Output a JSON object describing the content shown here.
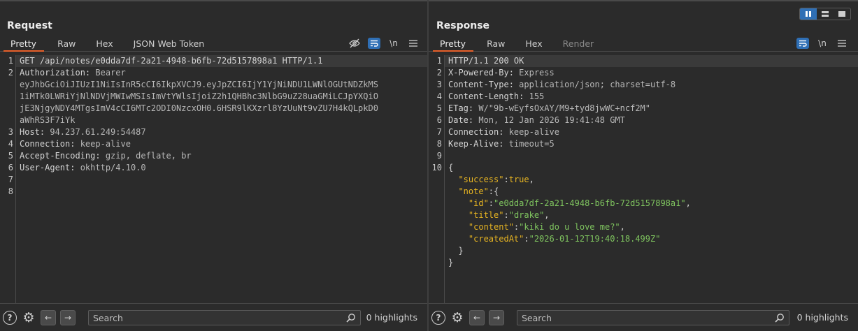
{
  "request": {
    "title": "Request",
    "tabs": [
      "Pretty",
      "Raw",
      "Hex",
      "JSON Web Token"
    ],
    "lines": [
      {
        "n": "1",
        "parts": [
          {
            "t": "GET /api/notes/e0dda7df-2a21-4948-b6fb-72d5157898a1 HTTP/1.1",
            "c": "k"
          }
        ]
      },
      {
        "n": "2",
        "parts": [
          {
            "t": "Authorization: ",
            "c": "k"
          },
          {
            "t": "Bearer",
            "c": "v"
          }
        ]
      },
      {
        "n": "",
        "parts": [
          {
            "t": "eyJhbGciOiJIUzI1NiIsInR5cCI6IkpXVCJ9.eyJpZCI6IjY1YjNiNDU1LWNlOGUtNDZkMS",
            "c": "v"
          }
        ]
      },
      {
        "n": "",
        "parts": [
          {
            "t": "1iMTk0LWRiYjNlNDVjMWIwMSIsImVtYWlsIjoiZ2h1QHBhc3NlbG9uZ28uaGMiLCJpYXQiO",
            "c": "v"
          }
        ]
      },
      {
        "n": "",
        "parts": [
          {
            "t": "jE3NjgyNDY4MTgsImV4cCI6MTc2ODI0NzcxOH0.6HSR9lKXzrl8YzUuNt9vZU7H4kQLpkD0",
            "c": "v"
          }
        ]
      },
      {
        "n": "",
        "parts": [
          {
            "t": "aWhRS3F7iYk",
            "c": "v"
          }
        ]
      },
      {
        "n": "3",
        "parts": [
          {
            "t": "Host: ",
            "c": "k"
          },
          {
            "t": "94.237.61.249:54487",
            "c": "v"
          }
        ]
      },
      {
        "n": "4",
        "parts": [
          {
            "t": "Connection: ",
            "c": "k"
          },
          {
            "t": "keep-alive",
            "c": "v"
          }
        ]
      },
      {
        "n": "5",
        "parts": [
          {
            "t": "Accept-Encoding: ",
            "c": "k"
          },
          {
            "t": "gzip, deflate, br",
            "c": "v"
          }
        ]
      },
      {
        "n": "6",
        "parts": [
          {
            "t": "User-Agent: ",
            "c": "k"
          },
          {
            "t": "okhttp/4.10.0",
            "c": "v"
          }
        ]
      },
      {
        "n": "7",
        "parts": []
      },
      {
        "n": "8",
        "parts": []
      }
    ],
    "search_placeholder": "Search",
    "highlights": "0 highlights"
  },
  "response": {
    "title": "Response",
    "tabs": [
      "Pretty",
      "Raw",
      "Hex",
      "Render"
    ],
    "lines": [
      {
        "n": "1",
        "parts": [
          {
            "t": "HTTP/1.1 200 OK",
            "c": "k"
          }
        ]
      },
      {
        "n": "2",
        "parts": [
          {
            "t": "X-Powered-By: ",
            "c": "k"
          },
          {
            "t": "Express",
            "c": "v"
          }
        ]
      },
      {
        "n": "3",
        "parts": [
          {
            "t": "Content-Type: ",
            "c": "k"
          },
          {
            "t": "application/json; charset=utf-8",
            "c": "v"
          }
        ]
      },
      {
        "n": "4",
        "parts": [
          {
            "t": "Content-Length: ",
            "c": "k"
          },
          {
            "t": "155",
            "c": "v"
          }
        ]
      },
      {
        "n": "5",
        "parts": [
          {
            "t": "ETag: ",
            "c": "k"
          },
          {
            "t": "W/\"9b-wEyfsOxAY/M9+tyd8jwWC+ncf2M\"",
            "c": "v"
          }
        ]
      },
      {
        "n": "6",
        "parts": [
          {
            "t": "Date: ",
            "c": "k"
          },
          {
            "t": "Mon, 12 Jan 2026 19:41:48 GMT",
            "c": "v"
          }
        ]
      },
      {
        "n": "7",
        "parts": [
          {
            "t": "Connection: ",
            "c": "k"
          },
          {
            "t": "keep-alive",
            "c": "v"
          }
        ]
      },
      {
        "n": "8",
        "parts": [
          {
            "t": "Keep-Alive: ",
            "c": "k"
          },
          {
            "t": "timeout=5",
            "c": "v"
          }
        ]
      },
      {
        "n": "9",
        "parts": []
      },
      {
        "n": "10",
        "parts": [
          {
            "t": "{",
            "c": "k"
          }
        ]
      },
      {
        "n": "",
        "parts": [
          {
            "t": "  \"success\"",
            "c": "jk"
          },
          {
            "t": ":",
            "c": "k"
          },
          {
            "t": "true",
            "c": "jb"
          },
          {
            "t": ",",
            "c": "k"
          }
        ]
      },
      {
        "n": "",
        "parts": [
          {
            "t": "  \"note\"",
            "c": "jk"
          },
          {
            "t": ":{",
            "c": "k"
          }
        ]
      },
      {
        "n": "",
        "parts": [
          {
            "t": "    \"id\"",
            "c": "jk"
          },
          {
            "t": ":",
            "c": "k"
          },
          {
            "t": "\"e0dda7df-2a21-4948-b6fb-72d5157898a1\"",
            "c": "js"
          },
          {
            "t": ",",
            "c": "k"
          }
        ]
      },
      {
        "n": "",
        "parts": [
          {
            "t": "    \"title\"",
            "c": "jk"
          },
          {
            "t": ":",
            "c": "k"
          },
          {
            "t": "\"drake\"",
            "c": "js"
          },
          {
            "t": ",",
            "c": "k"
          }
        ]
      },
      {
        "n": "",
        "parts": [
          {
            "t": "    \"content\"",
            "c": "jk"
          },
          {
            "t": ":",
            "c": "k"
          },
          {
            "t": "\"kiki do u love me?\"",
            "c": "js"
          },
          {
            "t": ",",
            "c": "k"
          }
        ]
      },
      {
        "n": "",
        "parts": [
          {
            "t": "    \"createdAt\"",
            "c": "jk"
          },
          {
            "t": ":",
            "c": "k"
          },
          {
            "t": "\"2026-01-12T19:40:18.499Z\"",
            "c": "js"
          }
        ]
      },
      {
        "n": "",
        "parts": [
          {
            "t": "  }",
            "c": "k"
          }
        ]
      },
      {
        "n": "",
        "parts": [
          {
            "t": "}",
            "c": "k"
          }
        ]
      }
    ],
    "search_placeholder": "Search",
    "highlights": "0 highlights"
  },
  "toolbar": {
    "newline_label": "\\n",
    "help_label": "?",
    "prev_label": "←",
    "next_label": "→"
  },
  "colors": {
    "accent": "#e8602a",
    "toggle_blue": "#2f6fb5",
    "json_key": "#e6b422",
    "json_string": "#7fc45f"
  }
}
